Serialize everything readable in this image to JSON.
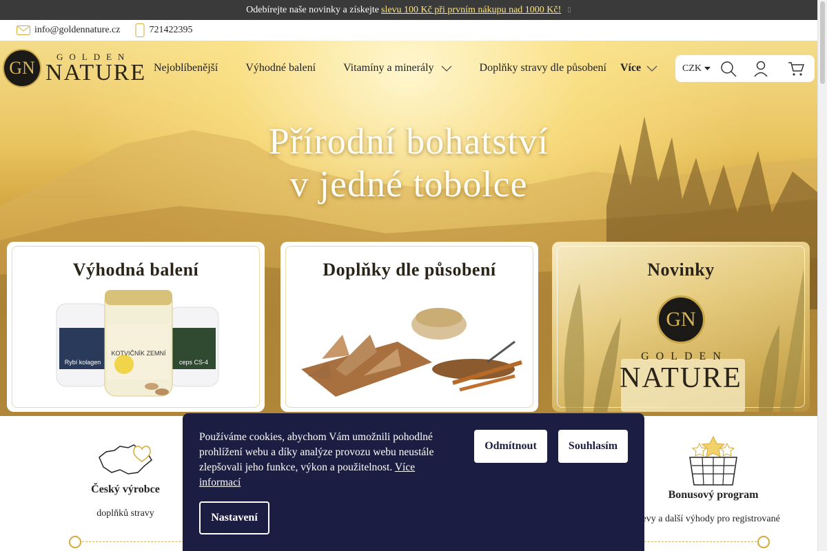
{
  "promo": {
    "text": "Odebírejte naše novinky a získejte",
    "link": "slevu 100 Kč při prvním nákupu nad 1000 Kč!",
    "close": "▯"
  },
  "contact": {
    "email": "info@goldennature.cz",
    "phone": "721422395"
  },
  "logo": {
    "monogram": "GN",
    "line1": "GOLDEN",
    "line2": "NATURE"
  },
  "nav": {
    "items": [
      {
        "label": "Nejoblíbenější"
      },
      {
        "label": "Výhodné balení"
      },
      {
        "label": "Vitamíny a minerály"
      },
      {
        "label": "Doplňky stravy dle působení"
      },
      {
        "label": "Více"
      }
    ]
  },
  "tools": {
    "currency": "CZK"
  },
  "hero": {
    "line1": "Přírodní bohatství",
    "line2": "v jedné tobolce"
  },
  "cards": [
    {
      "title": "Výhodná balení",
      "jar1": "Rybí kolagen",
      "jar2": "KOTVIČNÍK ZEMNÍ",
      "jar3": "ceps CS-4"
    },
    {
      "title": "Doplňky dle působení"
    },
    {
      "title": "Novinky",
      "brand1": "GOLDEN",
      "brand2": "NATURE"
    }
  ],
  "features": [
    {
      "title": "Český výrobce",
      "sub": "doplňků stravy"
    },
    {
      "title": "Bonusový program",
      "sub": "slevy a další výhody pro registrované"
    }
  ],
  "cookie": {
    "text": "Používáme cookies, abychom Vám umožnili pohodlné prohlížení webu a díky analýze provozu webu neustále zlepšovali jeho funkce, výkon a použitelnost.",
    "more": "Více informací",
    "reject": "Odmítnout",
    "accept": "Souhlasím",
    "settings": "Nastavení"
  },
  "colors": {
    "gold": "#d6a93a",
    "cookie_bg": "#1c1d43",
    "topbar_bg": "#3a3a3a"
  }
}
